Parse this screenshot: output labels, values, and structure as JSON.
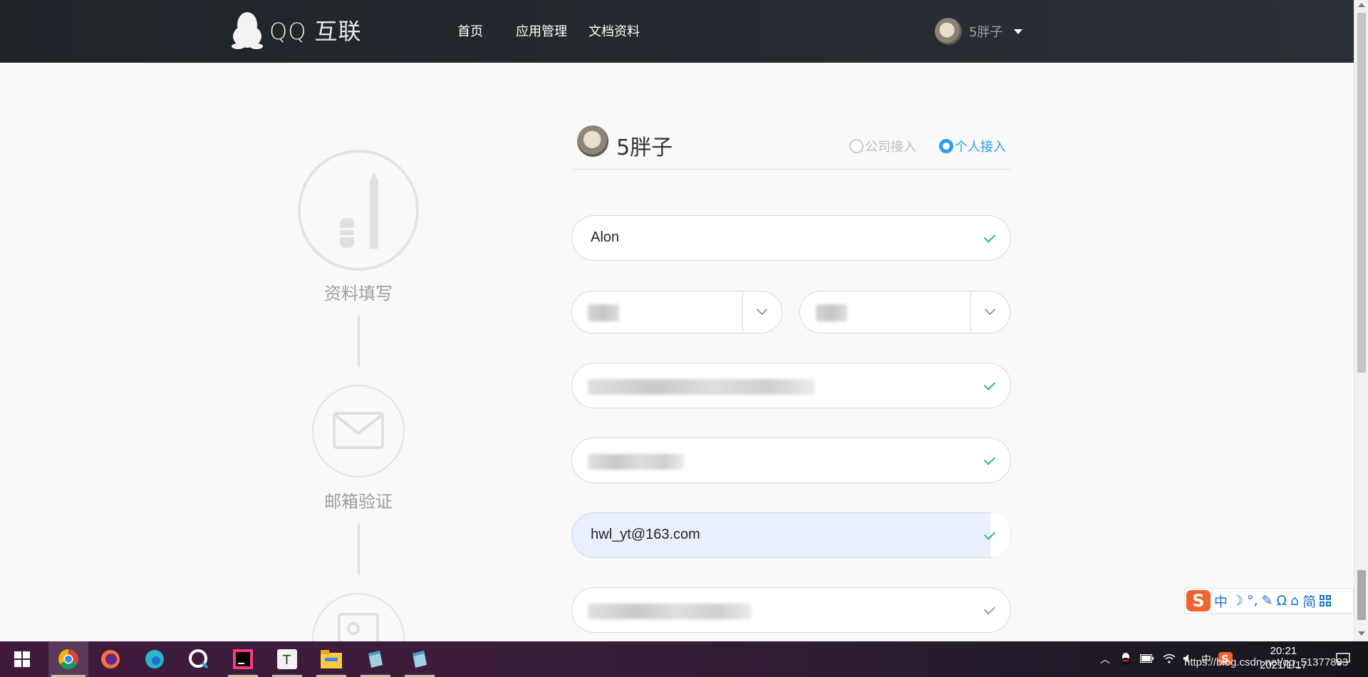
{
  "header": {
    "logo_text": "QQ 互联",
    "nav": [
      "首页",
      "应用管理",
      "文档资料"
    ],
    "user_name": "5胖子"
  },
  "steps": [
    {
      "label": "资料填写",
      "icon": "pen-ruler-icon"
    },
    {
      "label": "邮箱验证",
      "icon": "envelope-icon"
    },
    {
      "label": "",
      "icon": "id-card-icon"
    }
  ],
  "form": {
    "profile_name": "5胖子",
    "access_type_options": [
      "公司接入",
      "个人接入"
    ],
    "access_type_selected": "个人接入",
    "name_value": "Alon",
    "email_value": "hwl_yt@163.com"
  },
  "ime": {
    "chars": [
      "中",
      "☽",
      "°,",
      "✎",
      "Ω",
      "⌂",
      "简"
    ]
  },
  "taskbar": {
    "time": "20:21",
    "date": "2021/1/17",
    "ime_lang": "中",
    "url_watermark": "https://blog.csdn.net/qq_51377883"
  },
  "colors": {
    "topbar": "#22282e",
    "accent": "#2d9cf0",
    "check": "#2bb673",
    "highlight_field": "#e8f0fe"
  }
}
